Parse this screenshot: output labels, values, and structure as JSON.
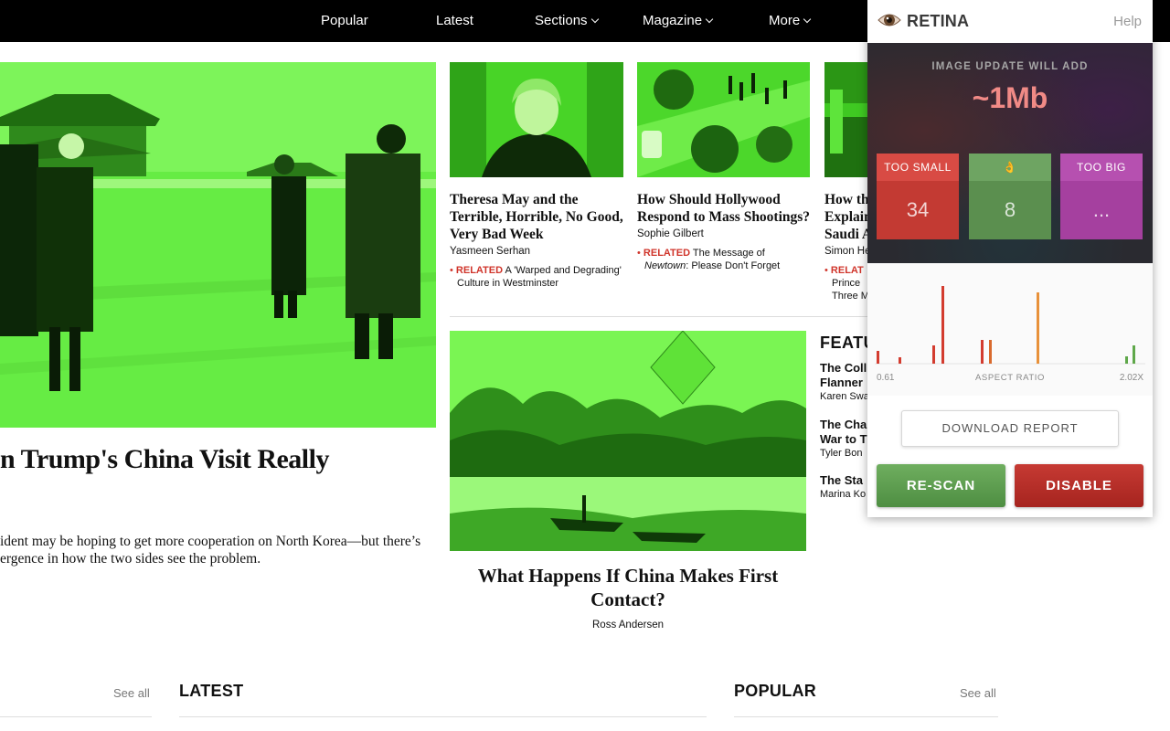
{
  "nav": {
    "items": [
      {
        "label": "Popular",
        "dropdown": false
      },
      {
        "label": "Latest",
        "dropdown": false
      },
      {
        "label": "Sections",
        "dropdown": true
      },
      {
        "label": "Magazine",
        "dropdown": true
      },
      {
        "label": "More",
        "dropdown": true
      }
    ]
  },
  "hero": {
    "title": "n Trump's China Visit Really",
    "dek_line1": "ident may be hoping to get more cooperation on North Korea—but there’s",
    "dek_line2": "ergence in how the two sides see the problem."
  },
  "stories": [
    {
      "title": "Theresa May and the Terrible, Horrible, No Good, Very Bad Week",
      "byline": "Yasmeen Serhan",
      "related_label": "RELATED",
      "related_text": "A 'Warped and Degrading' Culture in Westminster"
    },
    {
      "title": "How Should Hollywood Respond to Mass Shootings?",
      "byline": "Sophie Gilbert",
      "related_label": "RELATED",
      "related_text_pre": "The Message of",
      "related_italic": "Newtown",
      "related_text_post": ": Please Don't Forget"
    },
    {
      "title": "How th Explain Saudi A",
      "byline": "Simon He",
      "related_label": "RELAT",
      "related_text": "Prince Three M"
    }
  ],
  "center": {
    "title": "What Happens If China Makes First Contact?",
    "byline": "Ross Andersen"
  },
  "features": {
    "heading": "FEATU",
    "items": [
      {
        "title_line1": "The Coll",
        "title_line2": "Flanner",
        "byline": "Karen Swa"
      },
      {
        "title_line1": "The Cha",
        "title_line2": "War to T",
        "byline": "Tyler Bon"
      },
      {
        "title_line1": "The Sta",
        "title_line2": "",
        "byline": "Marina Ko"
      }
    ]
  },
  "sections": {
    "latest_heading": "LATEST",
    "popular_heading": "POPULAR",
    "see_all": "See all"
  },
  "retina": {
    "brand": "RETINA",
    "help": "Help",
    "update_label": "IMAGE UPDATE WILL ADD",
    "update_size": "~1Mb",
    "tiles": [
      {
        "label": "TOO SMALL",
        "value": "34",
        "color": "#c33a33"
      },
      {
        "label": "👌",
        "value": "8",
        "color": "#5b8f4f"
      },
      {
        "label": "TOO BIG",
        "value": "...",
        "color": "#a5409f"
      }
    ],
    "histogram": {
      "min_label": "0.61",
      "axis_label": "ASPECT RATIO",
      "max_label": "2.02X"
    },
    "buttons": {
      "report": "DOWNLOAD REPORT",
      "rescan": "RE-SCAN",
      "disable": "DISABLE"
    }
  }
}
